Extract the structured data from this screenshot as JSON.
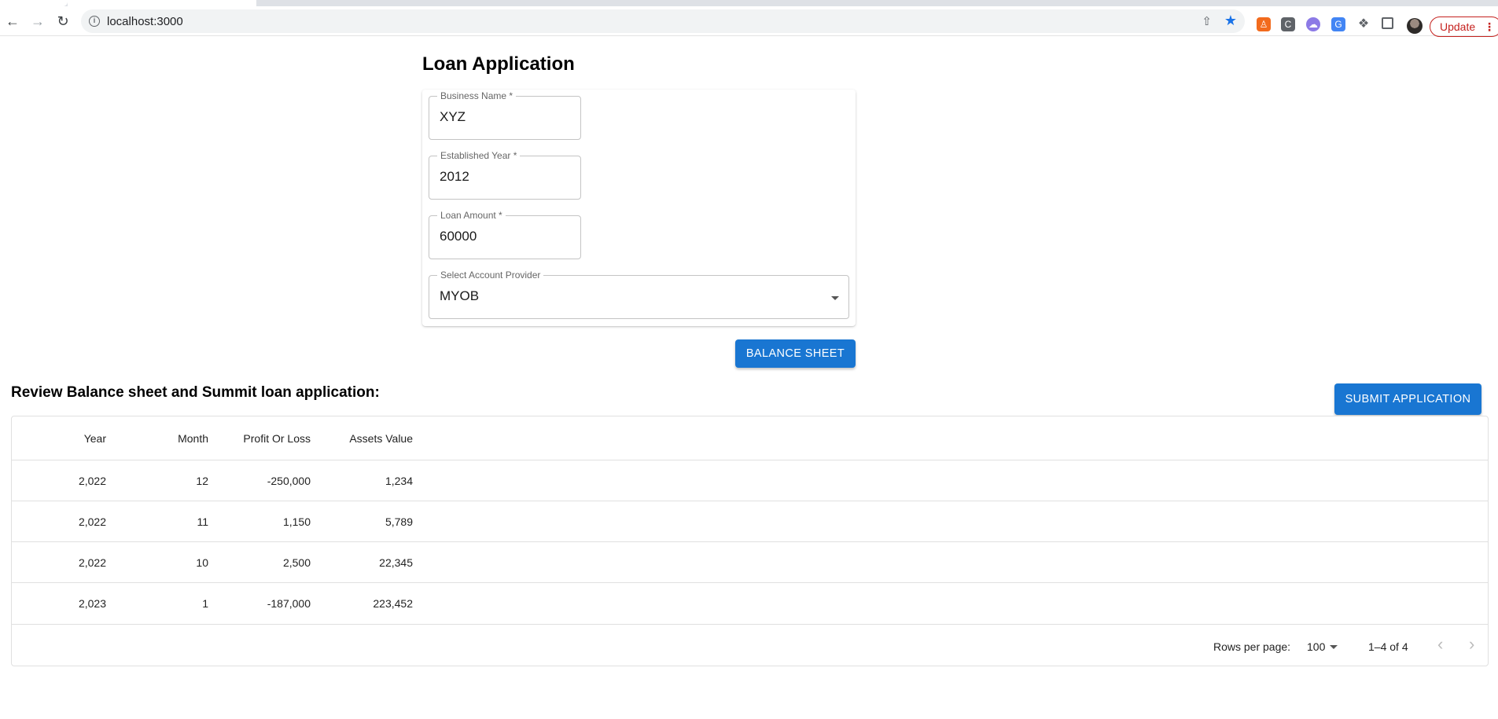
{
  "browser": {
    "url": "localhost:3000",
    "update_label": "Update",
    "accent": "#1a73e8"
  },
  "form": {
    "title": "Loan Application",
    "business_name": {
      "label": "Business Name *",
      "value": "XYZ"
    },
    "established_year": {
      "label": "Established Year *",
      "value": "2012"
    },
    "loan_amount": {
      "label": "Loan Amount *",
      "value": "60000"
    },
    "account_provider": {
      "label": "Select Account Provider",
      "value": "MYOB"
    },
    "balance_sheet_label": "BALANCE SHEET"
  },
  "review": {
    "title": "Review Balance sheet and Summit loan application:",
    "submit_label": "SUBMIT APPLICATION",
    "columns": [
      "Year",
      "Month",
      "Profit Or Loss",
      "Assets Value"
    ],
    "rows": [
      [
        "2,022",
        "12",
        "-250,000",
        "1,234"
      ],
      [
        "2,022",
        "11",
        "1,150",
        "5,789"
      ],
      [
        "2,022",
        "10",
        "2,500",
        "22,345"
      ],
      [
        "2,023",
        "1",
        "-187,000",
        "223,452"
      ]
    ],
    "rows_per_page_label": "Rows per page:",
    "rows_per_page_value": "100",
    "range_label": "1–4 of 4"
  },
  "colors": {
    "primary": "#1976d2",
    "update": "#c5221f"
  }
}
